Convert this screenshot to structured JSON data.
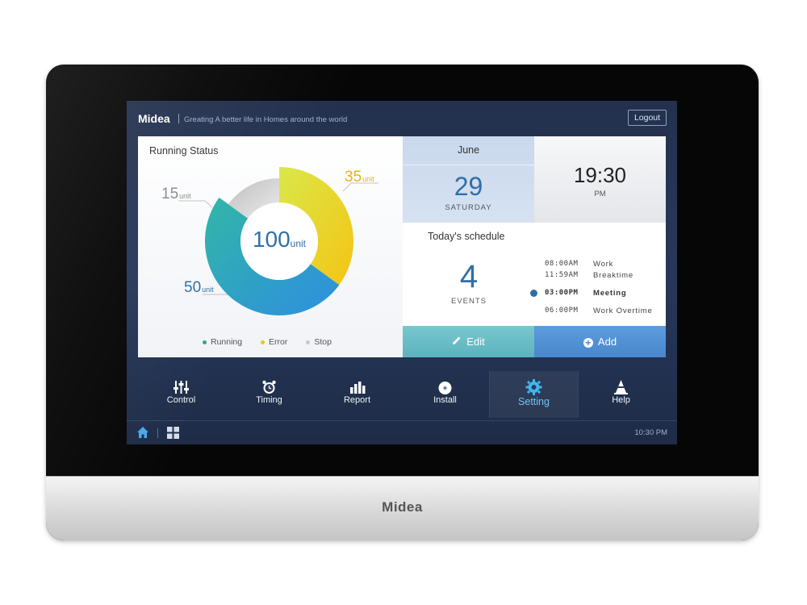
{
  "header": {
    "brand": "Midea",
    "tagline": "Greating A better life in Homes around the world",
    "logout_label": "Logout"
  },
  "running_status": {
    "title": "Running Status",
    "total": "100",
    "total_unit": "unit",
    "segments": [
      {
        "name": "Running",
        "value": "50",
        "unit": "unit",
        "color": "#2f9cd6"
      },
      {
        "name": "Error",
        "value": "35",
        "unit": "unit",
        "color": "#f2c416"
      },
      {
        "name": "Stop",
        "value": "15",
        "unit": "unit",
        "color": "#c8c8c8"
      }
    ],
    "legend": [
      "Running",
      "Error",
      "Stop"
    ]
  },
  "date": {
    "month": "June",
    "day": "29",
    "weekday": "SATURDAY"
  },
  "time": {
    "value": "19:30",
    "ampm": "PM"
  },
  "schedule": {
    "title": "Today's schedule",
    "count": "4",
    "count_label": "EVENTS",
    "items": [
      {
        "time": "08:00AM",
        "event": "Work",
        "active": false
      },
      {
        "time": "11:59AM",
        "event": "Breaktime",
        "active": false
      },
      {
        "time": "03:00PM",
        "event": "Meeting",
        "active": true
      },
      {
        "time": "06:00PM",
        "event": "Work Overtime",
        "active": false
      }
    ]
  },
  "actions": {
    "edit_label": "Edit",
    "add_label": "Add"
  },
  "nav": {
    "items": [
      {
        "label": "Control",
        "icon": "sliders-icon"
      },
      {
        "label": "Timing",
        "icon": "alarm-clock-icon"
      },
      {
        "label": "Report",
        "icon": "bar-chart-icon"
      },
      {
        "label": "Install",
        "icon": "disc-icon"
      },
      {
        "label": "Setting",
        "icon": "gear-icon",
        "active": true
      },
      {
        "label": "Help",
        "icon": "cone-icon"
      }
    ]
  },
  "footer": {
    "time": "10:30 PM"
  },
  "bezel": {
    "logo": "Midea"
  },
  "colors": {
    "accent": "#2f6fa8",
    "active_tab": "#6fc3f2",
    "edit_bg": "#6bbdc6",
    "add_bg": "#4f8fd2"
  }
}
